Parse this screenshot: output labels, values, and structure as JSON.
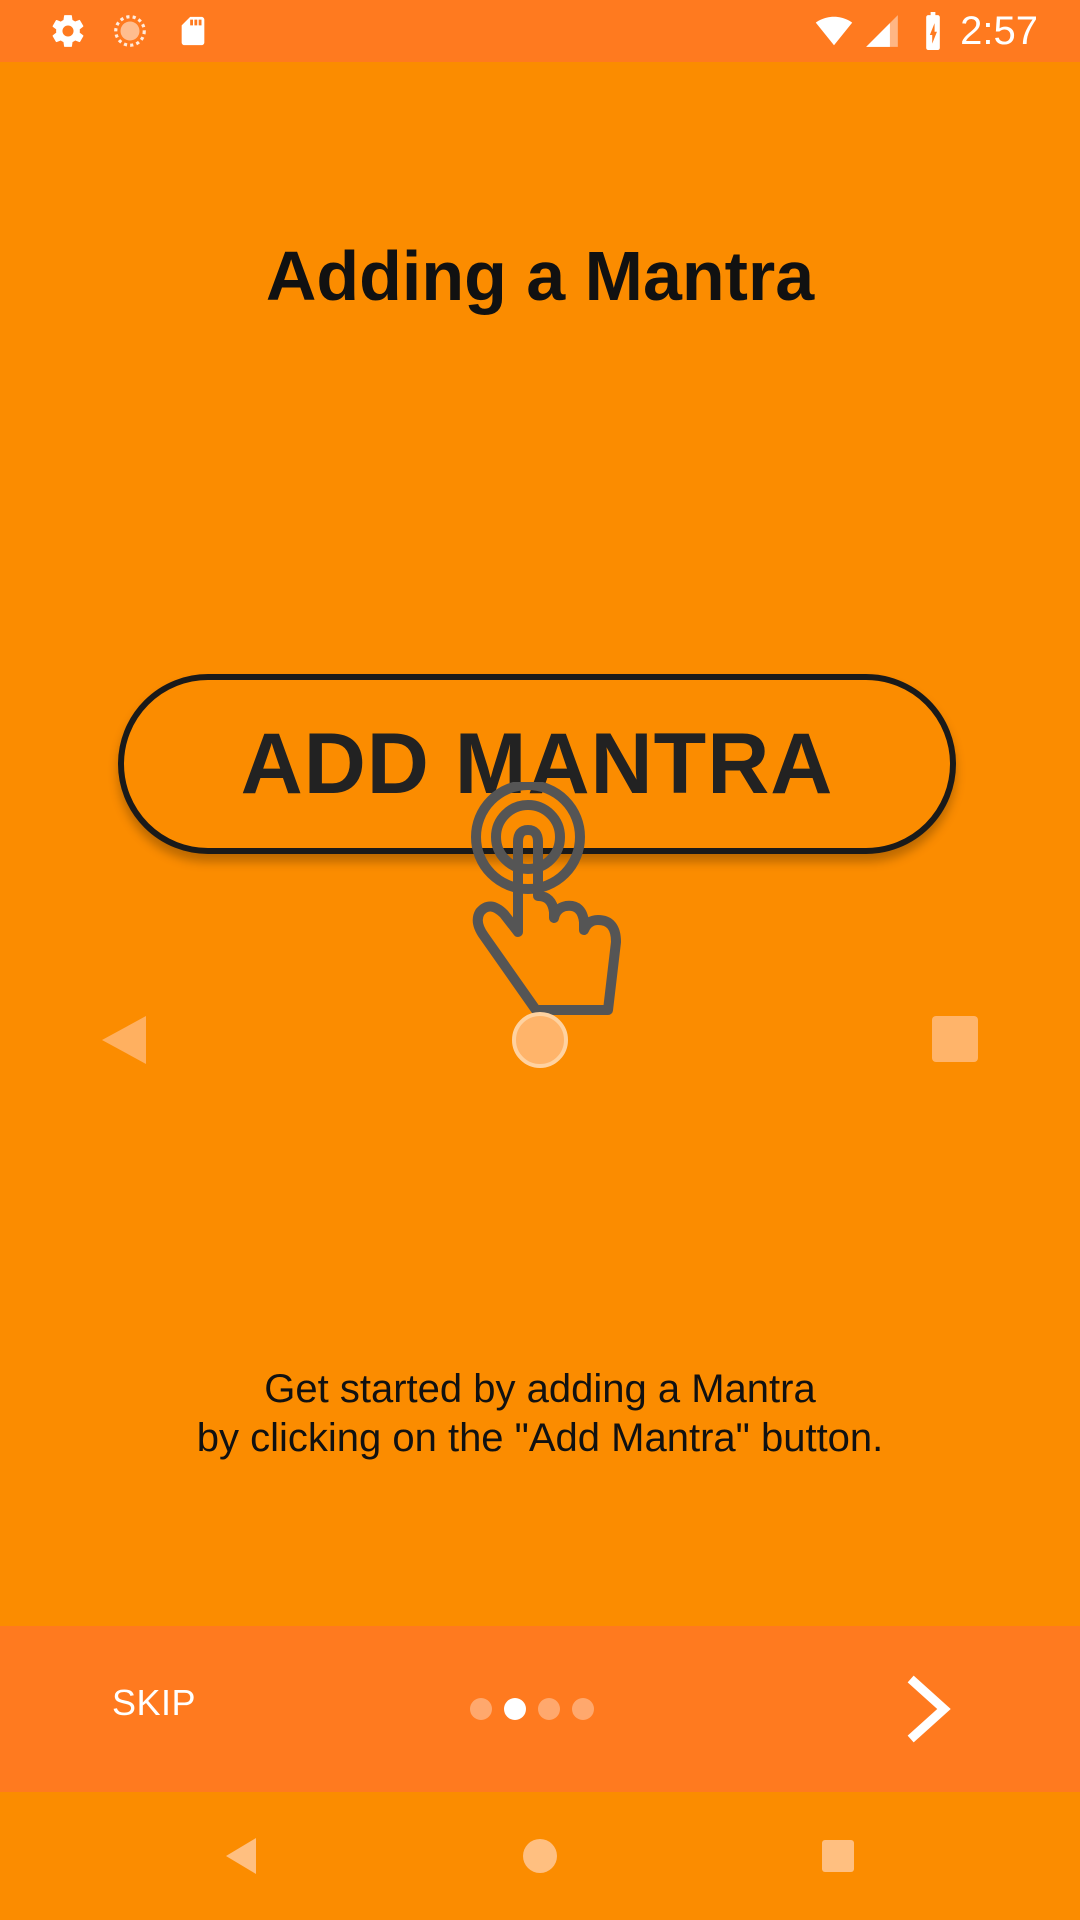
{
  "status_bar": {
    "time": "2:57",
    "left_icons": [
      "settings-icon",
      "sync-icon",
      "sd-card-icon"
    ],
    "right_icons": [
      "wifi-icon",
      "signal-icon",
      "battery-charging-icon"
    ]
  },
  "slide": {
    "title": "Adding a Mantra",
    "illustration": {
      "button_label": "ADD MANTRA",
      "icons": [
        "tap-hand-icon",
        "back-icon",
        "home-icon",
        "recents-icon"
      ]
    },
    "description_lines": [
      "Get started by adding a Mantra",
      "by clicking on the \"Add Mantra\" button."
    ]
  },
  "onboarding_nav": {
    "skip_label": "SKIP",
    "page_count": 4,
    "current_page": 2,
    "next_icon": "chevron-right-icon"
  },
  "system_nav": {
    "icons": [
      "back-icon",
      "home-icon",
      "recents-icon"
    ]
  },
  "colors": {
    "background": "#FB8C00",
    "bar": "#FF7A1F",
    "text": "#111111",
    "white": "#FFFFFF"
  }
}
